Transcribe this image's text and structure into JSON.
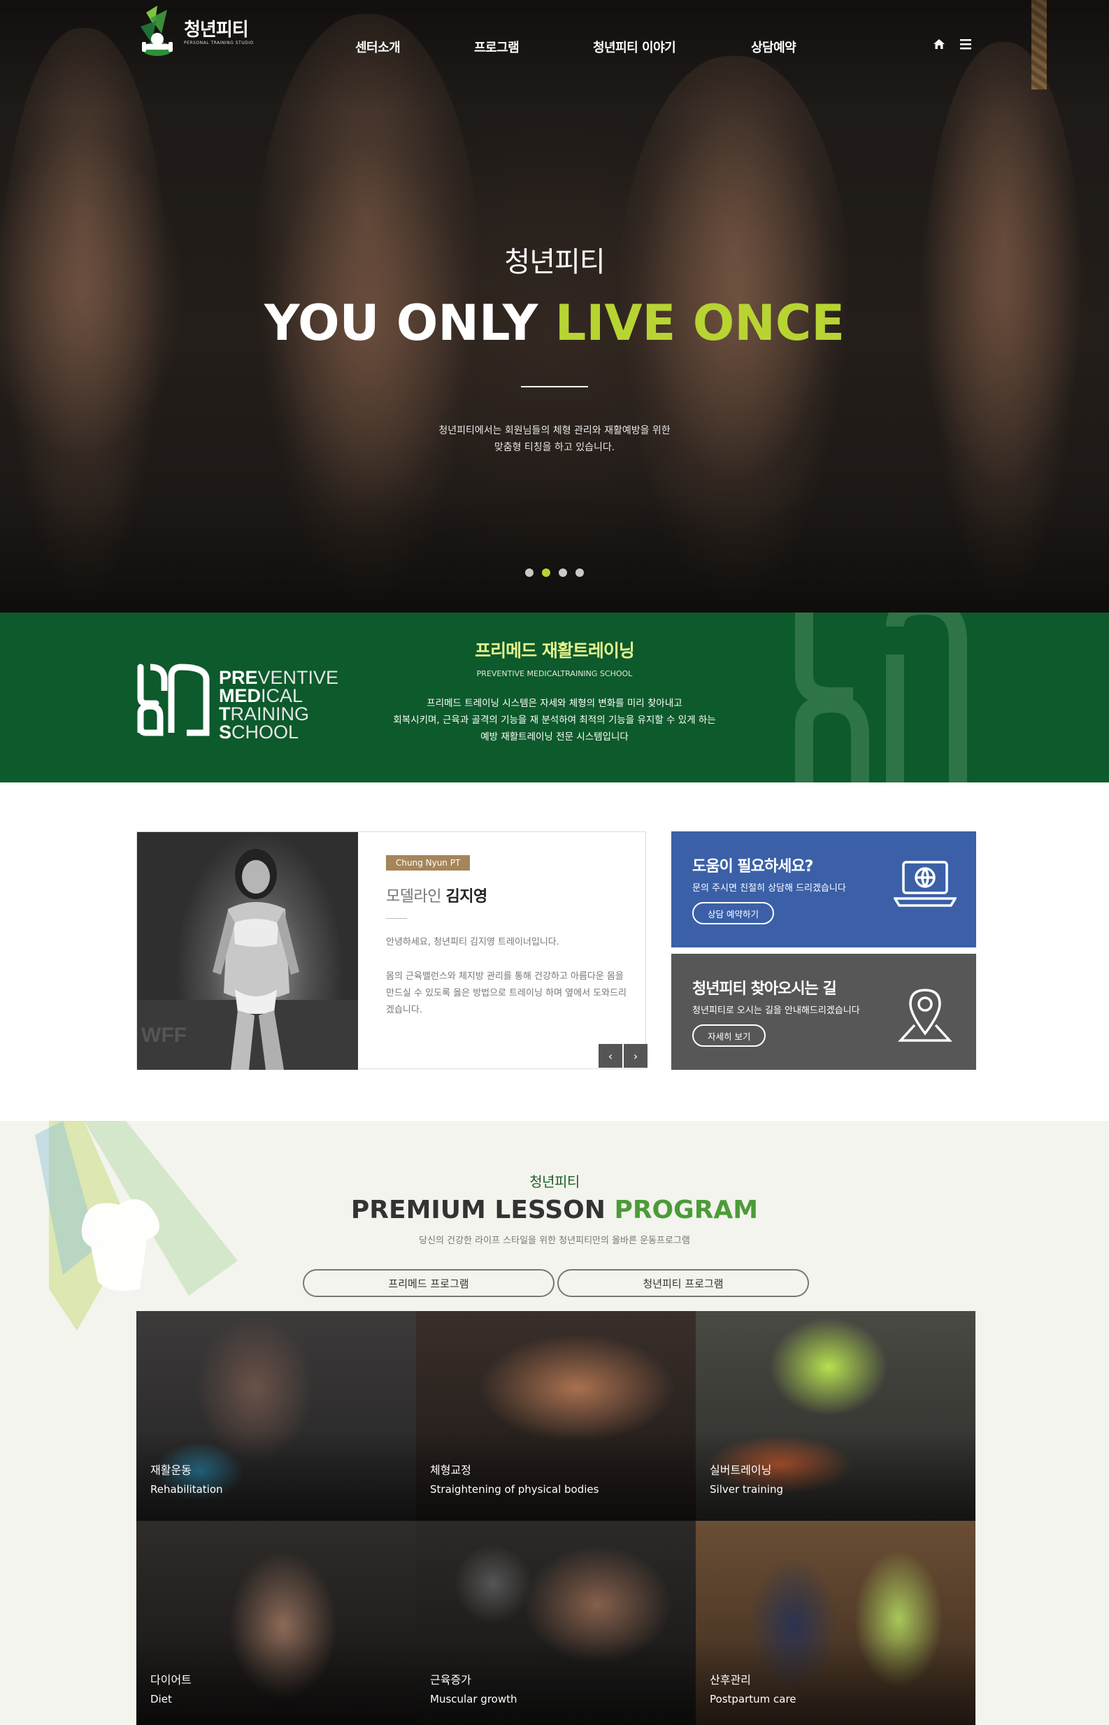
{
  "header": {
    "logo_ko": "청년피티",
    "logo_en": "PERSONAL TRAINING STUDIO",
    "nav": [
      {
        "label": "센터소개"
      },
      {
        "label": "프로그램"
      },
      {
        "label": "청년피티 이야기"
      },
      {
        "label": "상담예약"
      }
    ],
    "icons": [
      "home-icon",
      "menu-icon"
    ]
  },
  "hero": {
    "subtitle": "청년피티",
    "title_white": "YOU ONLY",
    "title_accent": "LIVE ONCE",
    "desc_line1": "청년피티에서는 회원님들의 체형 관리와 재활예방을 위한",
    "desc_line2": "맞춤형 티칭을 하고 있습니다.",
    "slide_count": 4,
    "active_slide": 2,
    "accent_color": "#b8d432"
  },
  "premed": {
    "logo_lines": [
      "PREVENTIVE",
      "MEDICAL",
      "TRAINING",
      "SCHOOL"
    ],
    "logo_bold": [
      "PRE",
      "MED",
      "T",
      "S"
    ],
    "logo_rest": [
      "VENTIVE",
      "ICAL",
      "RAINING",
      "CHOOL"
    ],
    "title": "프리메드 재활트레이닝",
    "subtitle": "PREVENTIVE MEDICALTRAINING SCHOOL",
    "desc_line1": "프리메드 트레이닝 시스템은 자세와 체형의 변화를 미리 찾아내고",
    "desc_line2": "회복시키며, 근육과 골격의 기능을 재 분석하여 최적의 기능을 유지할 수 있게 하는",
    "desc_line3": "예방 재활트레이닝 전문 시스템입니다",
    "bg_color": "#0d5a2c"
  },
  "trainer": {
    "badge": "Chung Nyun PT",
    "role": "모델라인",
    "name": "김지영",
    "intro": "안녕하세요, 청년피티 김지영 트레이너입니다.",
    "body": "몸의 근육밸런스와 체지방 관리를 통해 건강하고 아름다운 몸을 만드실 수 있도록 옳은 방법으로 트레이닝 하며 옆에서 도와드리겠습니다.",
    "prev_icon": "chevron-left-icon",
    "next_icon": "chevron-right-icon"
  },
  "cards": {
    "help": {
      "title": "도움이 필요하세요?",
      "desc": "문의 주시면 친절히 상담해 드리겠습니다",
      "button": "상담 예약하기",
      "icon": "laptop-globe-icon",
      "color": "#3b60a8"
    },
    "map": {
      "title": "청년피티 찾아오시는 길",
      "desc": "청년피티로 오시는 길을 안내해드리겠습니다",
      "button": "자세히 보기",
      "icon": "map-pin-icon",
      "color": "#575757"
    }
  },
  "program": {
    "eyebrow": "청년피티",
    "title_dark": "PREMIUM LESSON",
    "title_accent": "PROGRAM",
    "desc": "당신의 건강한 라이프 스타일을 위한 청년피티만의 올바른 운동프로그램",
    "tabs": [
      {
        "label": "프리메드 프로그램"
      },
      {
        "label": "청년피티 프로그램"
      }
    ],
    "tiles": [
      {
        "ko": "재활운동",
        "en": "Rehabilitation"
      },
      {
        "ko": "체형교정",
        "en": "Straightening of physical bodies"
      },
      {
        "ko": "실버트레이닝",
        "en": "Silver training"
      },
      {
        "ko": "다이어트",
        "en": "Diet"
      },
      {
        "ko": "근육증가",
        "en": "Muscular growth"
      },
      {
        "ko": "산후관리",
        "en": "Postpartum care"
      }
    ]
  }
}
